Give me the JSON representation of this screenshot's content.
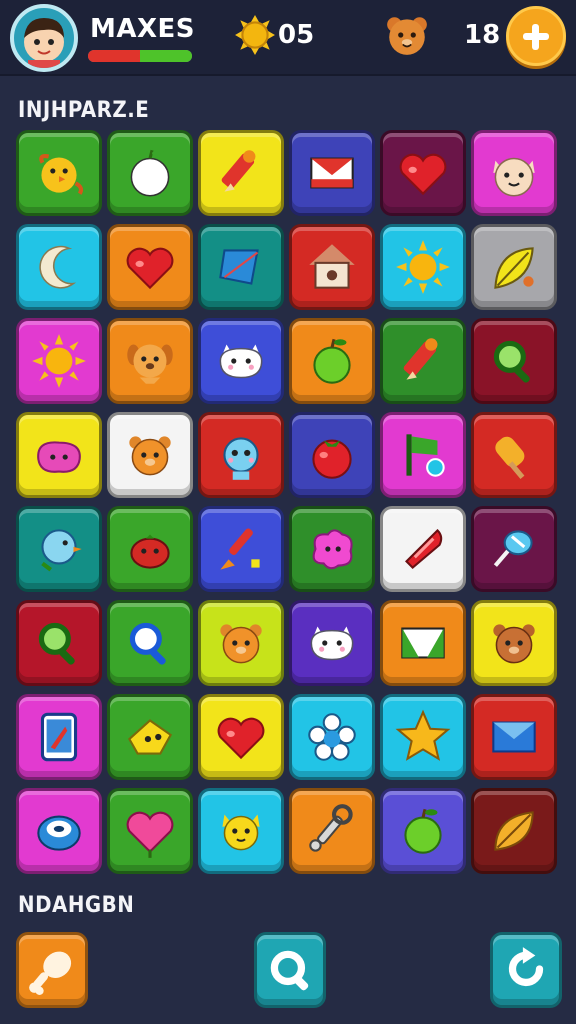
{
  "hud": {
    "player_name": "MAXES",
    "xp_progress": 0.5,
    "coins": "05",
    "pets": "18"
  },
  "sections": {
    "top_title": "INJHPARZ.E",
    "bottom_title": "NDAHGBN"
  },
  "tiles": [
    {
      "color": "#3aa62a",
      "icon": "chick-icon"
    },
    {
      "color": "#3aa62a",
      "icon": "apple-white-icon"
    },
    {
      "color": "#f2e41a",
      "icon": "pencil-icon"
    },
    {
      "color": "#3e43b8",
      "icon": "envelope-icon"
    },
    {
      "color": "#6a1548",
      "icon": "heart-icon"
    },
    {
      "color": "#e23ad0",
      "icon": "cat-face-icon"
    },
    {
      "color": "#22c4e6",
      "icon": "moon-icon"
    },
    {
      "color": "#f08a1a",
      "icon": "heart-icon"
    },
    {
      "color": "#138f86",
      "icon": "kite-icon"
    },
    {
      "color": "#d42a24",
      "icon": "birdhouse-icon"
    },
    {
      "color": "#22c4e6",
      "icon": "sun-icon"
    },
    {
      "color": "#a7a7ab",
      "icon": "leaf-icon"
    },
    {
      "color": "#e23ad0",
      "icon": "sun-icon"
    },
    {
      "color": "#f08a1a",
      "icon": "puppy-icon"
    },
    {
      "color": "#3e4ed8",
      "icon": "ghost-cat-icon"
    },
    {
      "color": "#f08a1a",
      "icon": "apple-green-icon"
    },
    {
      "color": "#2f8f2a",
      "icon": "pencil-icon"
    },
    {
      "color": "#8a1328",
      "icon": "magnifier-icon"
    },
    {
      "color": "#f2e41a",
      "icon": "blob-icon"
    },
    {
      "color": "#f4f4f4",
      "icon": "bear-icon"
    },
    {
      "color": "#d42a24",
      "icon": "robot-icon"
    },
    {
      "color": "#3e43b8",
      "icon": "tomato-icon"
    },
    {
      "color": "#e23ad0",
      "icon": "flag-icon"
    },
    {
      "color": "#d42a24",
      "icon": "popsicle-icon"
    },
    {
      "color": "#138f86",
      "icon": "bird-icon"
    },
    {
      "color": "#3aa62a",
      "icon": "berry-icon"
    },
    {
      "color": "#3e4ed8",
      "icon": "brush-icon"
    },
    {
      "color": "#2f8f2a",
      "icon": "blob-pink-icon"
    },
    {
      "color": "#f4f4f4",
      "icon": "cone-icon"
    },
    {
      "color": "#6a1548",
      "icon": "candy-icon"
    },
    {
      "color": "#b5162a",
      "icon": "magnifier-icon"
    },
    {
      "color": "#3aa62a",
      "icon": "magnifier-blue-icon"
    },
    {
      "color": "#c7e31a",
      "icon": "bear-icon"
    },
    {
      "color": "#5a2fc0",
      "icon": "ghost-cat-icon"
    },
    {
      "color": "#f08a1a",
      "icon": "envelope-green-icon"
    },
    {
      "color": "#f2e41a",
      "icon": "bear-brown-icon"
    },
    {
      "color": "#e23ad0",
      "icon": "tablet-icon"
    },
    {
      "color": "#3aa62a",
      "icon": "cheese-icon"
    },
    {
      "color": "#f2e41a",
      "icon": "heart-icon"
    },
    {
      "color": "#22c4e6",
      "icon": "flower-icon"
    },
    {
      "color": "#22c4e6",
      "icon": "star-icon"
    },
    {
      "color": "#d42a24",
      "icon": "envelope-blue-icon"
    },
    {
      "color": "#e23ad0",
      "icon": "donut-icon"
    },
    {
      "color": "#3aa62a",
      "icon": "heart-pink-icon"
    },
    {
      "color": "#22c4e6",
      "icon": "cat-yellow-icon"
    },
    {
      "color": "#f08a1a",
      "icon": "wrench-icon"
    },
    {
      "color": "#5a4fd6",
      "icon": "apple-green-icon"
    },
    {
      "color": "#7a1a1a",
      "icon": "leaf-gold-icon"
    }
  ],
  "bottom_buttons": [
    {
      "icon": "drumstick-icon"
    },
    {
      "icon": "magnifier-icon"
    },
    {
      "icon": "refresh-icon"
    }
  ]
}
